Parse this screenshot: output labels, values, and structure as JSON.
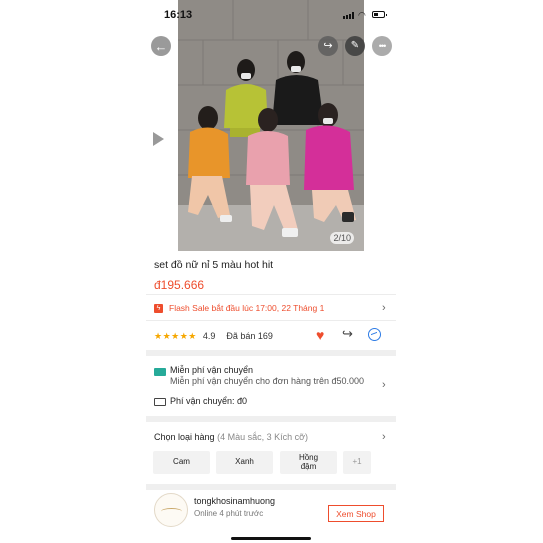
{
  "status": {
    "time": "16:13"
  },
  "gallery": {
    "counter": "2/10"
  },
  "icons": {
    "back": "back-arrow-icon",
    "share": "share-icon",
    "edit": "edit-icon",
    "more": "more-icon",
    "play": "play-icon",
    "heart": "heart-icon",
    "messenger": "messenger-icon",
    "truck": "truck-icon"
  },
  "product": {
    "title": "set đồ nữ nỉ 5 màu hot hit",
    "price": "đ195.666"
  },
  "flash_sale": {
    "text": "Flash Sale bắt đầu lúc 17:00, 22 Tháng 1"
  },
  "rating": {
    "stars": "★★★★★",
    "value": "4.9",
    "sold": "Đã bán 169"
  },
  "shipping": {
    "free_title": "Miễn phí vận chuyển",
    "free_sub": "Miễn phí vận chuyển cho đơn hàng trên đ50.000",
    "fee": "Phí vận chuyển: đ0"
  },
  "variants": {
    "label": "Chọn loại hàng",
    "summary": "(4 Màu sắc, 3 Kích cỡ)",
    "options": [
      "Cam",
      "Xanh",
      "Hồng\nđậm",
      "+1"
    ]
  },
  "shop": {
    "name": "tongkhosinamhuong",
    "status": "Online 4 phút trước",
    "button": "Xem Shop"
  },
  "colors": {
    "accent": "#ee4d2d",
    "star": "#f6a700",
    "messenger": "#2d7be5",
    "free_ship": "#26aa99"
  }
}
